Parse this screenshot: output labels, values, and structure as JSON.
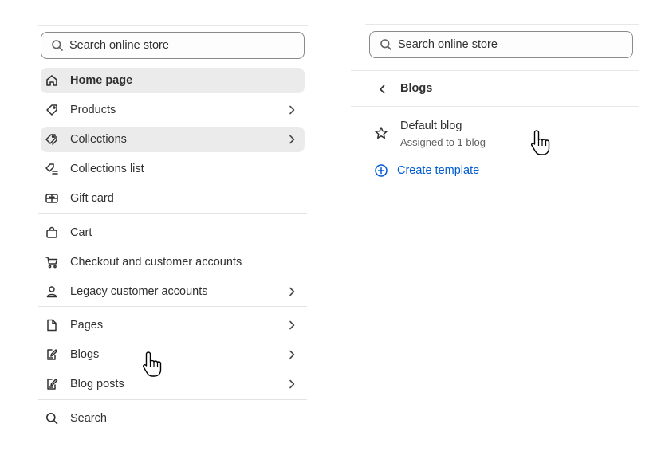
{
  "left_panel": {
    "search": {
      "placeholder": "Search online store",
      "value": ""
    },
    "items": [
      {
        "label": "Home page",
        "icon": "home-icon",
        "has_chevron": false,
        "active": true
      },
      {
        "label": "Products",
        "icon": "tag-icon",
        "has_chevron": true,
        "active": false
      },
      {
        "label": "Collections",
        "icon": "tags-icon",
        "has_chevron": true,
        "active": true
      },
      {
        "label": "Collections list",
        "icon": "tags-list-icon",
        "has_chevron": false,
        "active": false
      },
      {
        "label": "Gift card",
        "icon": "gift-card-icon",
        "has_chevron": false,
        "active": false
      },
      {
        "label": "Cart",
        "icon": "bag-icon",
        "has_chevron": false,
        "active": false
      },
      {
        "label": "Checkout and customer accounts",
        "icon": "cart-icon",
        "has_chevron": false,
        "active": false
      },
      {
        "label": "Legacy customer accounts",
        "icon": "person-icon",
        "has_chevron": true,
        "active": false
      },
      {
        "label": "Pages",
        "icon": "page-icon",
        "has_chevron": true,
        "active": false
      },
      {
        "label": "Blogs",
        "icon": "blog-icon",
        "has_chevron": true,
        "active": false
      },
      {
        "label": "Blog posts",
        "icon": "blog-post-icon",
        "has_chevron": true,
        "active": false
      },
      {
        "label": "Search",
        "icon": "search-icon",
        "has_chevron": false,
        "active": false
      }
    ]
  },
  "right_panel": {
    "search": {
      "placeholder": "Search online store",
      "value": ""
    },
    "header": {
      "title": "Blogs",
      "back_icon": "chevron-left-icon"
    },
    "blog": {
      "name": "Default blog",
      "subtitle": "Assigned to 1 blog",
      "icon": "star-icon"
    },
    "create": {
      "label": "Create template",
      "icon": "plus-circle-icon",
      "color": "#005bd3"
    }
  },
  "colors": {
    "text": "#303030",
    "muted": "#616161",
    "active_bg": "#ebebeb",
    "link": "#005bd3",
    "border": "#8a8a8a",
    "divider": "#e3e3e3"
  }
}
